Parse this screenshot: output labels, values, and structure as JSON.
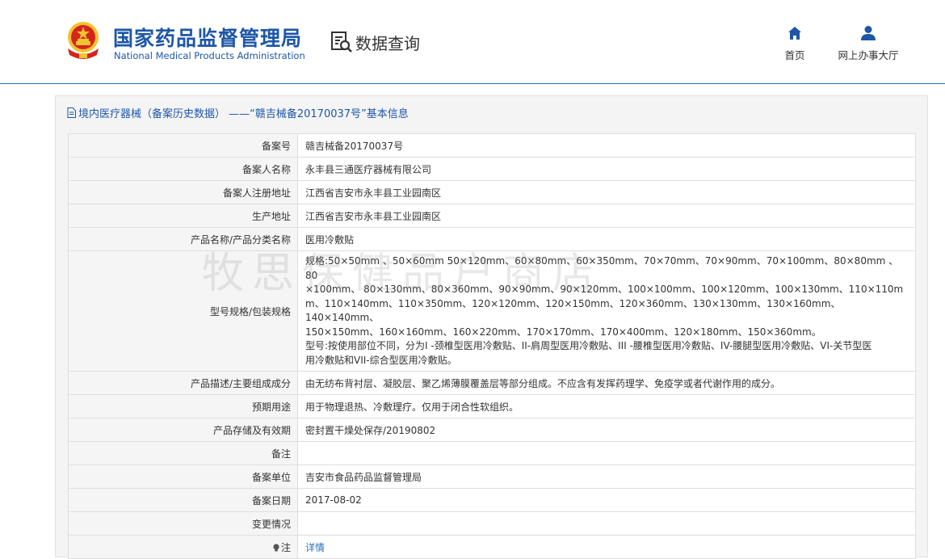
{
  "header": {
    "org_name_cn": "国家药品监督管理局",
    "org_name_en": "National Medical Products Administration",
    "query_label": "数据查询",
    "nav": [
      {
        "label": "首页",
        "icon": "home-icon"
      },
      {
        "label": "网上办事大厅",
        "icon": "user-icon"
      }
    ],
    "colors": {
      "brand": "#1d56a8",
      "emblem_red": "#d3261b",
      "emblem_gold": "#f2c230"
    }
  },
  "panel": {
    "title": "境内医疗器械（备案历史数据） ——“赣吉械备20170037号”基本信息"
  },
  "rows": {
    "record_no": {
      "label": "备案号",
      "value": "赣吉械备20170037号"
    },
    "registrant": {
      "label": "备案人名称",
      "value": "永丰县三通医疗器械有限公司"
    },
    "registrant_address": {
      "label": "备案人注册地址",
      "value": "江西省吉安市永丰县工业园南区"
    },
    "production_address": {
      "label": "生产地址",
      "value": "江西省吉安市永丰县工业园南区"
    },
    "product_name": {
      "label": "产品名称/产品分类名称",
      "value": "医用冷敷贴"
    },
    "model_spec": {
      "label": "型号规格/包装规格",
      "lines": [
        "规格:50×50mm 、50×60mm 50×120mm、60×80mm、60×350mm、70×70mm、70×90mm、70×100mm、80×80mm 、80",
        "×100mm、 80×130mm、80×360mm、90×90mm、90×120mm、100×100mm、100×120mm、100×130mm、110×110m",
        "m、110×140mm、110×350mm、120×120mm、120×150mm、120×360mm、130×130mm、130×160mm、140×140mm、",
        "150×150mm、160×160mm、160×220mm、170×170mm、170×400mm、120×180mm、150×360mm。",
        "型号:按使用部位不同，分为I -颈椎型医用冷敷贴、II-肩周型医用冷敷贴、III -腰椎型医用冷敷贴、IV-腰腿型医用冷敷贴、VI-关节型医",
        "用冷敷贴和VII-综合型医用冷敷贴。"
      ]
    },
    "description": {
      "label": "产品描述/主要组成成分",
      "value": "由无纺布背衬层、凝胶层、聚乙烯薄膜覆盖层等部分组成。不应含有发挥药理学、免疫学或者代谢作用的成分。"
    },
    "intended_use": {
      "label": "预期用途",
      "value": "用于物理退热、冷敷理疗。仅用于闭合性软组织。"
    },
    "storage": {
      "label": "产品存储及有效期",
      "value": "密封置干燥处保存/20190802"
    },
    "remark": {
      "label": "备注",
      "value": ""
    },
    "record_unit": {
      "label": "备案单位",
      "value": "吉安市食品药品监督管理局"
    },
    "record_date": {
      "label": "备案日期",
      "value": "2017-08-02"
    },
    "changes": {
      "label": "变更情况",
      "value": ""
    },
    "note": {
      "label": "注",
      "value": "详情"
    }
  },
  "watermark": "牧思保健品户商店"
}
